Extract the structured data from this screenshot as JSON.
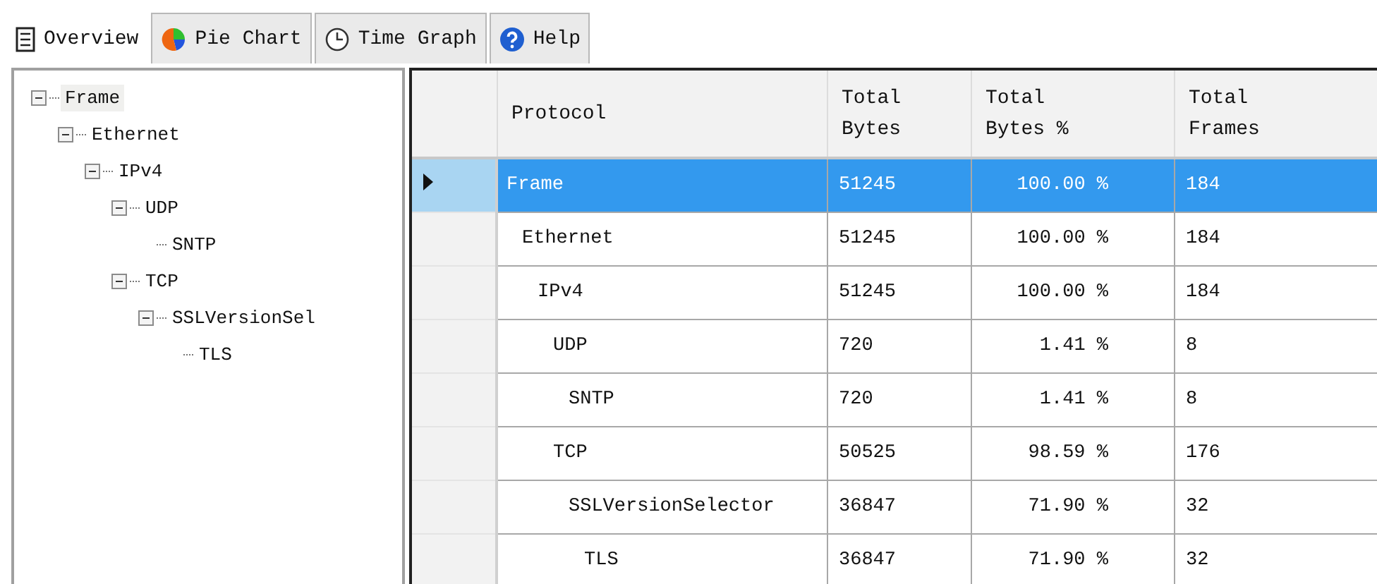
{
  "tabs": [
    {
      "label": "Overview",
      "kind": "document",
      "selected": true
    },
    {
      "label": "Pie Chart",
      "kind": "pie",
      "selected": false
    },
    {
      "label": "Time Graph",
      "kind": "clock",
      "selected": false
    },
    {
      "label": "Help",
      "kind": "help",
      "selected": false
    }
  ],
  "tree": [
    {
      "label": "Frame",
      "selected": true,
      "expanded": true,
      "children": [
        {
          "label": "Ethernet",
          "selected": false,
          "expanded": true,
          "children": [
            {
              "label": "IPv4",
              "selected": false,
              "expanded": true,
              "children": [
                {
                  "label": "UDP",
                  "selected": false,
                  "expanded": true,
                  "children": [
                    {
                      "label": "SNTP",
                      "selected": false
                    }
                  ]
                },
                {
                  "label": "TCP",
                  "selected": false,
                  "expanded": true,
                  "children": [
                    {
                      "label": "SSLVersionSel",
                      "selected": false,
                      "expanded": true,
                      "children": [
                        {
                          "label": "TLS",
                          "selected": false
                        }
                      ]
                    }
                  ]
                }
              ]
            }
          ]
        }
      ]
    }
  ],
  "table": {
    "columns": [
      "Protocol",
      "Total Bytes",
      "Total Bytes %",
      "Total Frames"
    ],
    "rows": [
      {
        "protocol": "Frame",
        "bytes": "51245",
        "percent": "100.00 %",
        "frames": "184",
        "selected": true,
        "children": [
          {
            "protocol": "Ethernet",
            "bytes": "51245",
            "percent": "100.00 %",
            "frames": "184",
            "selected": false,
            "children": [
              {
                "protocol": "IPv4",
                "bytes": "51245",
                "percent": "100.00 %",
                "frames": "184",
                "selected": false,
                "children": [
                  {
                    "protocol": "UDP",
                    "bytes": "720",
                    "percent": "1.41 %",
                    "frames": "8",
                    "selected": false,
                    "children": [
                      {
                        "protocol": "SNTP",
                        "bytes": "720",
                        "percent": "1.41 %",
                        "frames": "8",
                        "selected": false
                      }
                    ]
                  },
                  {
                    "protocol": "TCP",
                    "bytes": "50525",
                    "percent": "98.59 %",
                    "frames": "176",
                    "selected": false,
                    "children": [
                      {
                        "protocol": "SSLVersionSelector",
                        "bytes": "36847",
                        "percent": "71.90 %",
                        "frames": "32",
                        "selected": false,
                        "children": [
                          {
                            "protocol": "TLS",
                            "bytes": "36847",
                            "percent": "71.90 %",
                            "frames": "32",
                            "selected": false
                          }
                        ]
                      }
                    ]
                  }
                ]
              }
            ]
          }
        ]
      }
    ]
  }
}
